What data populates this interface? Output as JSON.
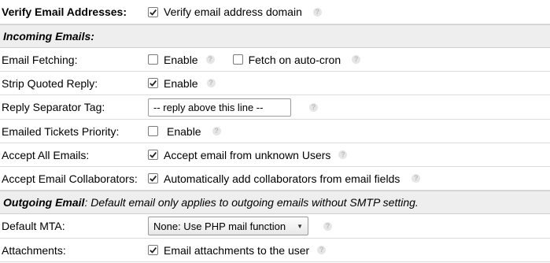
{
  "rows": {
    "verify_email": {
      "label": "Verify Email Addresses:",
      "checkbox_label": "Verify email address domain",
      "checked": true
    },
    "incoming_header": "Incoming Emails:",
    "email_fetching": {
      "label": "Email Fetching:",
      "enable_label": "Enable",
      "enable_checked": false,
      "autocron_label": "Fetch on auto-cron",
      "autocron_checked": false
    },
    "strip_quoted": {
      "label": "Strip Quoted Reply:",
      "enable_label": "Enable",
      "checked": true
    },
    "reply_separator": {
      "label": "Reply Separator Tag:",
      "value": "-- reply above this line --"
    },
    "emailed_priority": {
      "label": "Emailed Tickets Priority:",
      "enable_label": "Enable",
      "checked": false
    },
    "accept_all": {
      "label": "Accept All Emails:",
      "checkbox_label": "Accept email from unknown Users",
      "checked": true
    },
    "accept_collab": {
      "label": "Accept Email Collaborators:",
      "checkbox_label": "Automatically add collaborators from email fields",
      "checked": true
    },
    "outgoing_header": {
      "title": "Outgoing Email",
      "note": ": Default email only applies to outgoing emails without SMTP setting."
    },
    "default_mta": {
      "label": "Default MTA:",
      "selected": "None: Use PHP mail function"
    },
    "attachments": {
      "label": "Attachments:",
      "checkbox_label": "Email attachments to the user",
      "checked": true
    }
  },
  "icons": {
    "help": "question-help-icon",
    "check": "checkmark-icon",
    "dropdown": "dropdown-arrow-icon"
  }
}
